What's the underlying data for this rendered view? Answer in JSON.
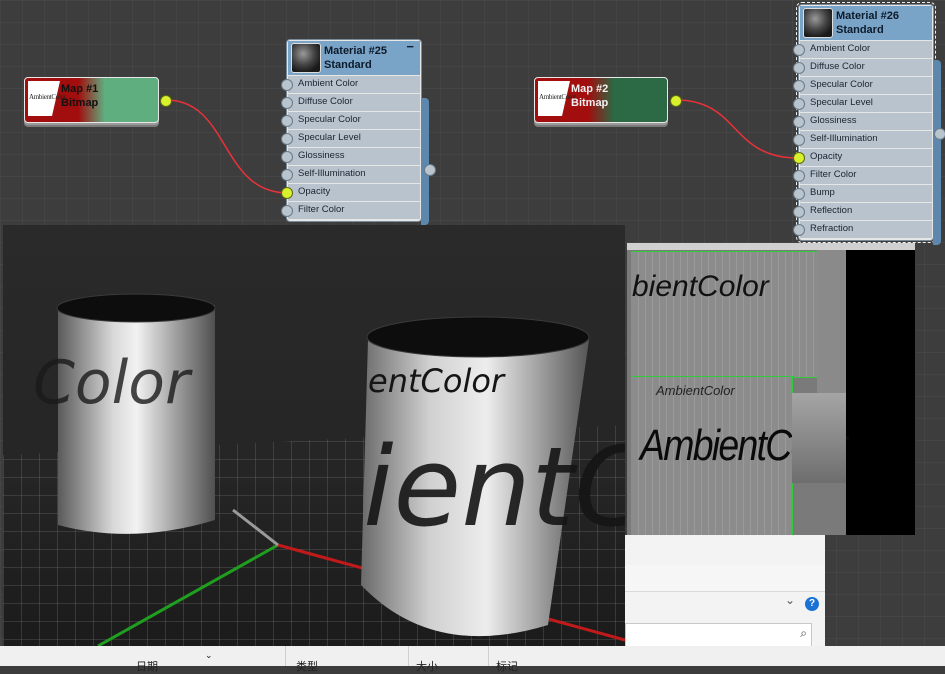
{
  "map_nodes": [
    {
      "id": "map1",
      "title": "Map #1",
      "type": "Bitmap",
      "thumb_text": "AmbientColor"
    },
    {
      "id": "map2",
      "title": "Map #2",
      "type": "Bitmap",
      "thumb_text": "AmbientColor"
    }
  ],
  "material_25": {
    "title": "Material #25",
    "subtitle": "Standard",
    "collapse": "−",
    "slots": [
      "Ambient Color",
      "Diffuse Color",
      "Specular Color",
      "Specular Level",
      "Glossiness",
      "Self-Illumination",
      "Opacity",
      "Filter Color"
    ],
    "active_slot": "Opacity"
  },
  "material_26": {
    "title": "Material #26",
    "subtitle": "Standard",
    "slots": [
      "Ambient Color",
      "Diffuse Color",
      "Specular Color",
      "Specular Level",
      "Glossiness",
      "Self-Illumination",
      "Opacity",
      "Filter Color",
      "Bump",
      "Reflection",
      "Refraction"
    ],
    "active_slot": "Opacity"
  },
  "viewport": {
    "left_cylinder_text": "Color",
    "right_cylinder_top_text": "entColor",
    "right_cylinder_main_text": "ientC"
  },
  "texture_preview": {
    "top_text": "bientColor",
    "small_text": "AmbientColor",
    "big_text": "AmbientColor"
  },
  "dialog": {
    "help_label": "?",
    "chevron": "⌄",
    "columns": [
      "日期",
      "类型",
      "大小",
      "标记"
    ]
  },
  "colors": {
    "wire": "#e8323a",
    "port_active": "#d9f02e",
    "map1_green": "#5fae80",
    "map2_green": "#2b6a45",
    "node_header": "#7aa4c7"
  }
}
